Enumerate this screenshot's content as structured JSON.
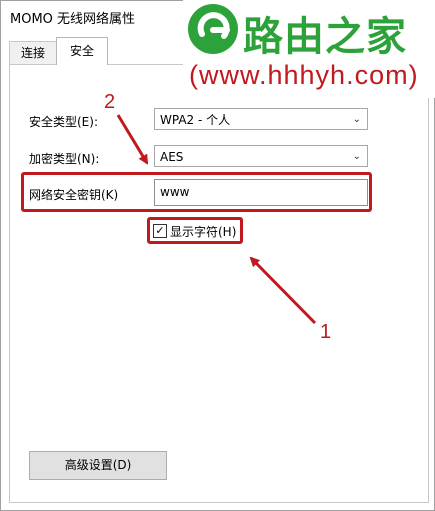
{
  "window": {
    "title": "MOMO 无线网络属性"
  },
  "tabs": [
    {
      "label": "连接"
    },
    {
      "label": "安全"
    }
  ],
  "form": {
    "security_type_label": "安全类型(E):",
    "security_type_value": "WPA2 - 个人",
    "encryption_type_label": "加密类型(N):",
    "encryption_type_value": "AES",
    "key_label": "网络安全密钥(K)",
    "key_value": "www",
    "show_chars_label": "显示字符(H)",
    "show_chars_checked": true
  },
  "advanced_button": "高级设置(D)",
  "annotations": {
    "step1": "1",
    "step2": "2",
    "color": "#c0191e"
  },
  "watermark": {
    "name": "路由之家",
    "url": "(www.hhhyh.com)",
    "brand_color": "#2ea23a"
  }
}
